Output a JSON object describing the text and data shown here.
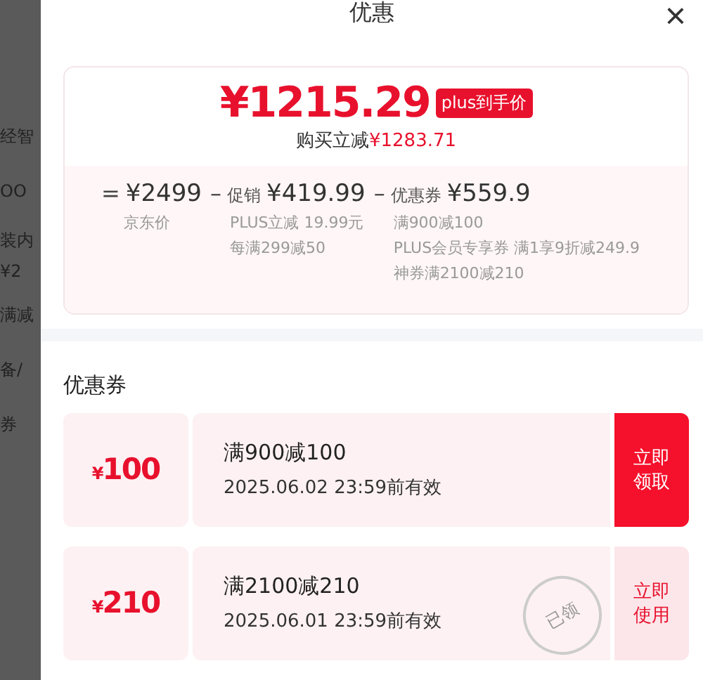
{
  "background_page": {
    "fragments": [
      "经智",
      "OO",
      "装内",
      "¥2",
      "满减",
      "备/",
      "券"
    ]
  },
  "panel": {
    "title": "优惠",
    "close": "×"
  },
  "price_card": {
    "final_price": "¥1215.29",
    "badge": "plus到手价",
    "saving_label": "购买立减",
    "saving_amount": "¥1283.71",
    "breakdown": [
      {
        "op": "=",
        "amount": "¥2499",
        "notes": [
          "京东价"
        ]
      },
      {
        "op": "–",
        "label": "促销",
        "amount": "¥419.99",
        "notes": [
          "PLUS立减 19.99元",
          "每满299减50"
        ]
      },
      {
        "op": "–",
        "label": "优惠券",
        "amount": "¥559.9",
        "notes": [
          "满900减100",
          "PLUS会员专享券 满1享9折减249.9",
          "神券满2100减210"
        ]
      }
    ]
  },
  "coupons_section": {
    "title": "优惠券",
    "coupons": [
      {
        "value": "100",
        "currency": "¥",
        "condition": "满900减100",
        "validity": "2025.06.02 23:59前有效",
        "action": "立即领取",
        "claimed": false
      },
      {
        "value": "210",
        "currency": "¥",
        "condition": "满2100减210",
        "validity": "2025.06.01 23:59前有效",
        "action": "立即使用",
        "claimed": true,
        "stamp": "已领"
      }
    ]
  }
}
